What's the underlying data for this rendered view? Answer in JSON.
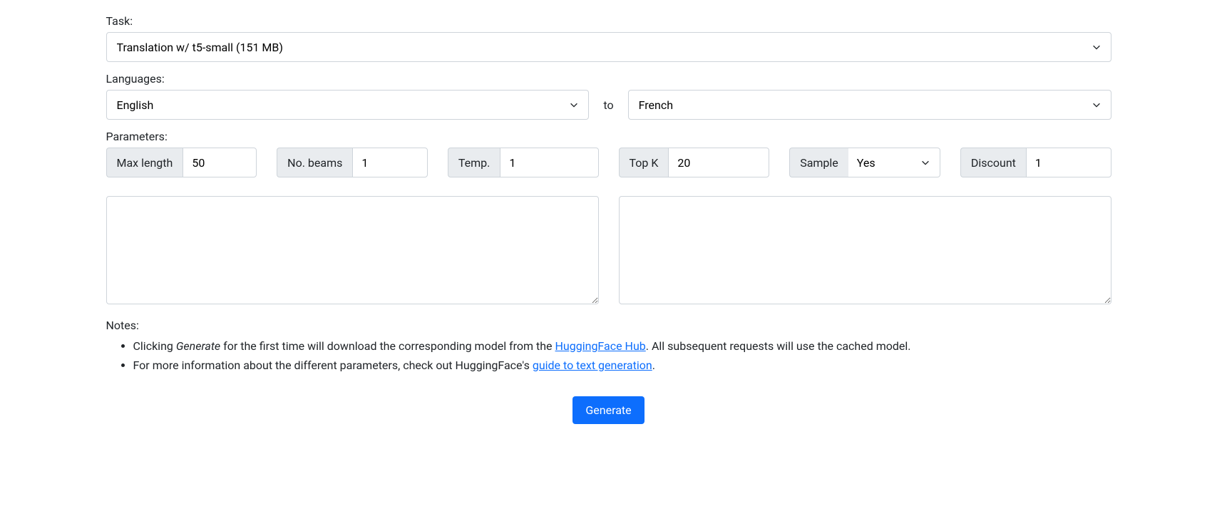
{
  "task": {
    "label": "Task:",
    "value": "Translation w/ t5-small (151 MB)"
  },
  "languages": {
    "label": "Languages:",
    "source": "English",
    "to": "to",
    "target": "French"
  },
  "parameters": {
    "label": "Parameters:",
    "max_length": {
      "label": "Max length",
      "value": "50"
    },
    "no_beams": {
      "label": "No. beams",
      "value": "1"
    },
    "temp": {
      "label": "Temp.",
      "value": "1"
    },
    "top_k": {
      "label": "Top K",
      "value": "20"
    },
    "sample": {
      "label": "Sample",
      "value": "Yes"
    },
    "discount": {
      "label": "Discount",
      "value": "1"
    }
  },
  "input_text": "",
  "output_text": "",
  "notes": {
    "label": "Notes:",
    "item1_prefix": "Clicking ",
    "item1_generate": "Generate",
    "item1_mid": " for the first time will download the corresponding model from the ",
    "item1_link": "HuggingFace Hub",
    "item1_suffix": ". All subsequent requests will use the cached model.",
    "item2_prefix": "For more information about the different parameters, check out HuggingFace's ",
    "item2_link": "guide to text generation",
    "item2_suffix": "."
  },
  "generate_label": "Generate"
}
